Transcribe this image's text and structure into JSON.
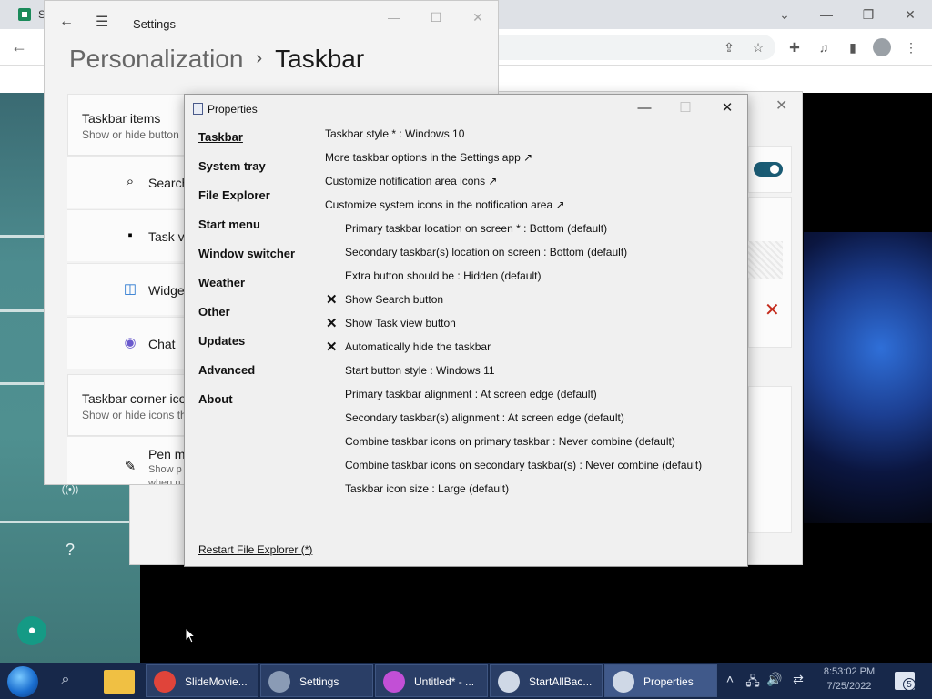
{
  "browser": {
    "tab_text": "S",
    "controls": {
      "chevron": "⌄",
      "minimize": "—",
      "restore": "❐",
      "close": "✕"
    },
    "toolbar_icons": [
      "share-icon",
      "star-icon",
      "extensions-icon",
      "media-icon",
      "sidepanel-icon",
      "profile-icon",
      "menu-icon"
    ]
  },
  "settings": {
    "title": "Settings",
    "breadcrumb_parent": "Personalization",
    "breadcrumb_sep": "›",
    "breadcrumb_current": "Taskbar",
    "taskbar_items_title": "Taskbar items",
    "taskbar_items_sub": "Show or hide button",
    "items": [
      {
        "label": "Search",
        "icon": "search-icon"
      },
      {
        "label": "Task vi",
        "icon": "task-view-icon"
      },
      {
        "label": "Widge",
        "icon": "widgets-icon"
      },
      {
        "label": "Chat",
        "icon": "chat-icon"
      }
    ],
    "corner_title": "Taskbar corner ico",
    "corner_sub": "Show or hide icons th",
    "pen_title": "Pen m",
    "pen_sub1": "Show p",
    "pen_sub2": "when n"
  },
  "left_strip": {
    "icons": [
      "network-icon",
      "help-icon",
      "bell-icon"
    ],
    "help_glyph": "?",
    "network_glyph": "((•))",
    "bell_glyph": "🔔"
  },
  "properties": {
    "title": "Properties",
    "nav": [
      "Taskbar",
      "System tray",
      "File Explorer",
      "Start menu",
      "Window switcher",
      "Weather",
      "Other",
      "Updates",
      "Advanced",
      "About"
    ],
    "active_nav": "Taskbar",
    "rows": [
      {
        "text": "Taskbar style * : Windows 10",
        "indent": false,
        "checked": false
      },
      {
        "text": "More taskbar options in the Settings app ↗",
        "indent": false,
        "checked": false
      },
      {
        "text": "Customize notification area icons ↗",
        "indent": false,
        "checked": false
      },
      {
        "text": "Customize system icons in the notification area ↗",
        "indent": false,
        "checked": false
      },
      {
        "text": "Primary taskbar location on screen * : Bottom (default)",
        "indent": true,
        "checked": false
      },
      {
        "text": "Secondary taskbar(s) location on screen : Bottom (default)",
        "indent": true,
        "checked": false
      },
      {
        "text": "Extra button should be : Hidden (default)",
        "indent": true,
        "checked": false
      },
      {
        "text": "Show Search button",
        "indent": true,
        "checked": true
      },
      {
        "text": "Show Task view button",
        "indent": true,
        "checked": true
      },
      {
        "text": "Automatically hide the taskbar",
        "indent": true,
        "checked": true
      },
      {
        "text": "Start button style : Windows 11",
        "indent": true,
        "checked": false
      },
      {
        "text": "Primary taskbar alignment : At screen edge (default)",
        "indent": true,
        "checked": false
      },
      {
        "text": "Secondary taskbar(s) alignment : At screen edge (default)",
        "indent": true,
        "checked": false
      },
      {
        "text": "Combine taskbar icons on primary taskbar : Never combine (default)",
        "indent": true,
        "checked": false
      },
      {
        "text": "Combine taskbar icons on secondary taskbar(s) : Never combine (default)",
        "indent": true,
        "checked": false
      },
      {
        "text": "Taskbar icon size : Large (default)",
        "indent": true,
        "checked": false
      }
    ],
    "check_glyph": "✕",
    "restart_link": "Restart File Explorer (*)",
    "controls": {
      "minimize": "—",
      "maximize": "☐",
      "close": "✕"
    }
  },
  "taskbar": {
    "buttons": [
      {
        "label": "SlideMovie...",
        "icon": "chrome-icon",
        "color": "#e0443a"
      },
      {
        "label": "Settings",
        "icon": "settings-icon",
        "color": "#8a9bb5"
      },
      {
        "label": "Untitled* - ...",
        "icon": "paint-icon",
        "color": "#c24fd6"
      },
      {
        "label": "StartAllBac...",
        "icon": "startallback-icon",
        "color": "#cfd8e6"
      },
      {
        "label": "Properties",
        "icon": "properties-icon",
        "color": "#cfd8e6"
      }
    ],
    "active_button": "Properties",
    "tray_glyphs": {
      "chevron": "˄",
      "network": "🖧",
      "volume": "🔊",
      "sync": "⇄"
    },
    "time": "8:53:02 PM",
    "date": "7/25/2022",
    "notification_count": "5"
  },
  "colors": {
    "taskbar_bg": "#17284a",
    "toggle_on": "#1a5b74",
    "close_red": "#c42b1c"
  }
}
